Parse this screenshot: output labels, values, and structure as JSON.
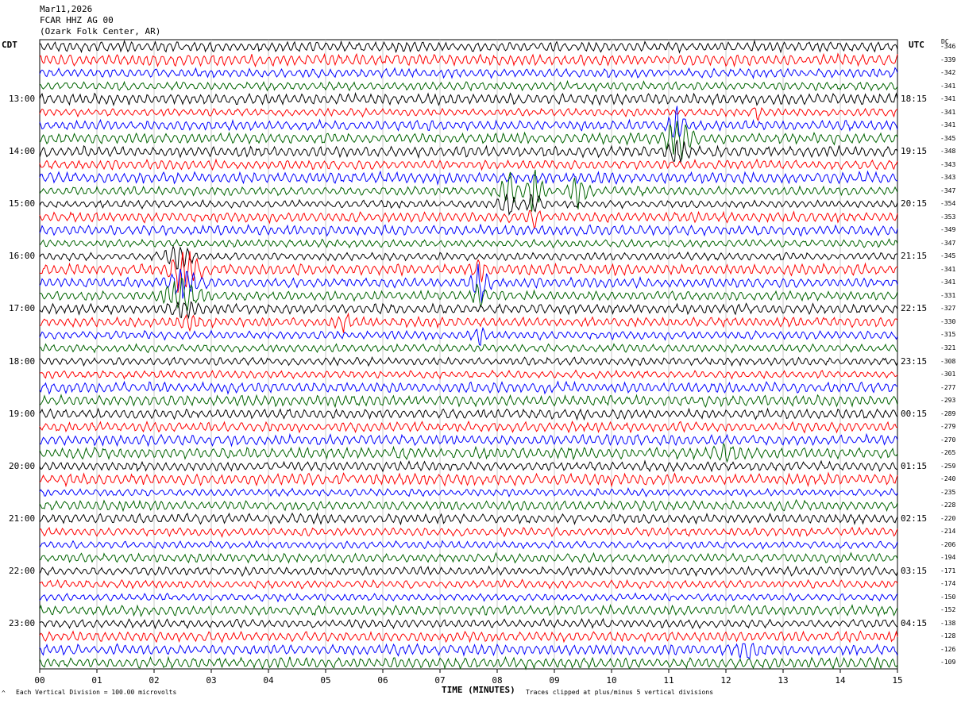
{
  "header": {
    "date": "Mar11,2026",
    "channel": "FCAR HHZ AG 00",
    "location": "(Ozark Folk Center, AR)"
  },
  "left_zone_label": "CDT",
  "right_zone_label": "UTC",
  "dc_header": "DC",
  "footer": {
    "scale_note": "Each Vertical Division = 100.00 microvolts",
    "clip_note": "Traces clipped at plus/minus 5 vertical divisions",
    "corner_mark": "^"
  },
  "colors": {
    "trace": [
      "#000000",
      "#ff0000",
      "#0000ff",
      "#006400"
    ],
    "grid": "#c8c8c8"
  },
  "chart_data": {
    "type": "line",
    "title": "FCAR HHZ AG 00",
    "xlabel": "TIME (MINUTES)",
    "xlim": [
      0,
      15
    ],
    "x_ticks": [
      "00",
      "01",
      "02",
      "03",
      "04",
      "05",
      "06",
      "07",
      "08",
      "09",
      "10",
      "11",
      "12",
      "13",
      "14",
      "15"
    ],
    "row_count": 48,
    "left_time_labels": [
      "13:00",
      "14:00",
      "15:00",
      "16:00",
      "17:00",
      "18:00",
      "19:00",
      "20:00",
      "21:00",
      "22:00",
      "23:00"
    ],
    "right_time_labels": [
      "18:15",
      "19:15",
      "20:15",
      "21:15",
      "22:15",
      "23:15",
      "00:15",
      "01:15",
      "02:15",
      "03:15",
      "04:15"
    ],
    "dc_offsets": [
      "-346",
      "-339",
      "-342",
      "-341",
      "-341",
      "-341",
      "-341",
      "-345",
      "-348",
      "-343",
      "-343",
      "-347",
      "-354",
      "-353",
      "-349",
      "-347",
      "-345",
      "-341",
      "-341",
      "-331",
      "-327",
      "-330",
      "-315",
      "-321",
      "-308",
      "-301",
      "-277",
      "-293",
      "-289",
      "-279",
      "-270",
      "-265",
      "-259",
      "-240",
      "-235",
      "-228",
      "-220",
      "-214",
      "-206",
      "-194",
      "-171",
      "-174",
      "-150",
      "-152",
      "-138",
      "-128",
      "-126",
      "-109"
    ],
    "events": [
      {
        "row": 5,
        "minute": 12.55,
        "width_min": 0.15,
        "amp": 2.0
      },
      {
        "row": 6,
        "minute": 11.15,
        "width_min": 0.3,
        "amp": 3.5
      },
      {
        "row": 7,
        "minute": 11.15,
        "width_min": 0.45,
        "amp": 5.0
      },
      {
        "row": 8,
        "minute": 11.15,
        "width_min": 0.3,
        "amp": 3.5
      },
      {
        "row": 11,
        "minute": 8.2,
        "width_min": 0.3,
        "amp": 4.0
      },
      {
        "row": 11,
        "minute": 8.65,
        "width_min": 0.3,
        "amp": 4.5
      },
      {
        "row": 11,
        "minute": 9.4,
        "width_min": 0.35,
        "amp": 3.5
      },
      {
        "row": 12,
        "minute": 8.2,
        "width_min": 0.3,
        "amp": 2.5
      },
      {
        "row": 12,
        "minute": 8.65,
        "width_min": 0.3,
        "amp": 2.5
      },
      {
        "row": 13,
        "minute": 8.65,
        "width_min": 0.25,
        "amp": 1.5
      },
      {
        "row": 16,
        "minute": 2.4,
        "width_min": 0.5,
        "amp": 3.0
      },
      {
        "row": 17,
        "minute": 2.5,
        "width_min": 0.55,
        "amp": 5.0
      },
      {
        "row": 17,
        "minute": 7.7,
        "width_min": 0.25,
        "amp": 2.0
      },
      {
        "row": 18,
        "minute": 2.5,
        "width_min": 0.55,
        "amp": 3.5
      },
      {
        "row": 18,
        "minute": 7.7,
        "width_min": 0.3,
        "amp": 5.0
      },
      {
        "row": 19,
        "minute": 2.5,
        "width_min": 0.6,
        "amp": 4.0
      },
      {
        "row": 19,
        "minute": 7.7,
        "width_min": 0.25,
        "amp": 3.0
      },
      {
        "row": 20,
        "minute": 2.5,
        "width_min": 0.45,
        "amp": 1.8
      },
      {
        "row": 21,
        "minute": 2.6,
        "width_min": 0.5,
        "amp": 1.5
      },
      {
        "row": 21,
        "minute": 5.3,
        "width_min": 0.3,
        "amp": 1.5
      },
      {
        "row": 22,
        "minute": 7.7,
        "width_min": 0.2,
        "amp": 2.0
      },
      {
        "row": 31,
        "minute": 12.0,
        "width_min": 0.4,
        "amp": 1.8
      },
      {
        "row": 46,
        "minute": 12.4,
        "width_min": 0.4,
        "amp": 1.8
      }
    ]
  }
}
